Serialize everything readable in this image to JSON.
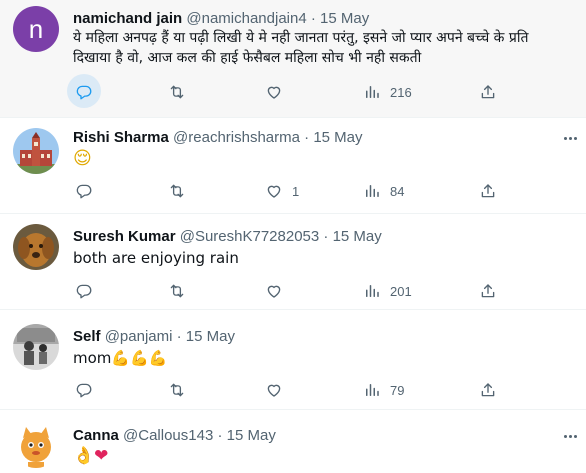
{
  "tweets": [
    {
      "name": "namichand jain",
      "handle": "@namichandjain4",
      "sep": "·",
      "date": "15 May",
      "avatar_letter": "n",
      "text_lines": [
        "ये महिला अनपढ़ हैं या पढ़ी लिखी ये मे नही जानता परंतु, इसने जो प्यार अपने बच्चे के प्रति",
        "दिखाया है वो, आज कल की हाई फेसैबल महिला सोच भी नही सकती"
      ],
      "replies": "",
      "retweets": "",
      "likes": "",
      "views": "216"
    },
    {
      "name": "Rishi Sharma",
      "handle": "@reachrishsharma",
      "sep": "·",
      "date": "15 May",
      "text": "😌",
      "replies": "",
      "retweets": "",
      "likes": "1",
      "views": "84"
    },
    {
      "name": "Suresh Kumar",
      "handle": "@SureshK77282053",
      "sep": "·",
      "date": "15 May",
      "text": "both are enjoying rain",
      "replies": "",
      "retweets": "",
      "likes": "",
      "views": "201"
    },
    {
      "name": "Self",
      "handle": "@panjami",
      "sep": "·",
      "date": "15 May",
      "text": "mom",
      "text_emoji": "💪💪💪",
      "replies": "",
      "retweets": "",
      "likes": "",
      "views": "79"
    },
    {
      "name": "Canna",
      "handle": "@Callous143",
      "sep": "·",
      "date": "15 May",
      "text_emoji_a": "👌",
      "text_emoji_b": "❤",
      "replies": "",
      "retweets": "",
      "likes": "",
      "views": ""
    }
  ],
  "icons": {
    "reply": "speech-bubble-icon",
    "retweet": "retweet-arrows-icon",
    "like": "heart-outline-icon",
    "views": "bar-chart-icon",
    "share": "share-arrow-icon",
    "more": "more-dots-icon"
  },
  "colors": {
    "accent": "#1d9bf0",
    "muted": "#536471",
    "hover_bg": "#f7f7f7",
    "avatar_n": "#7b3fa8"
  }
}
